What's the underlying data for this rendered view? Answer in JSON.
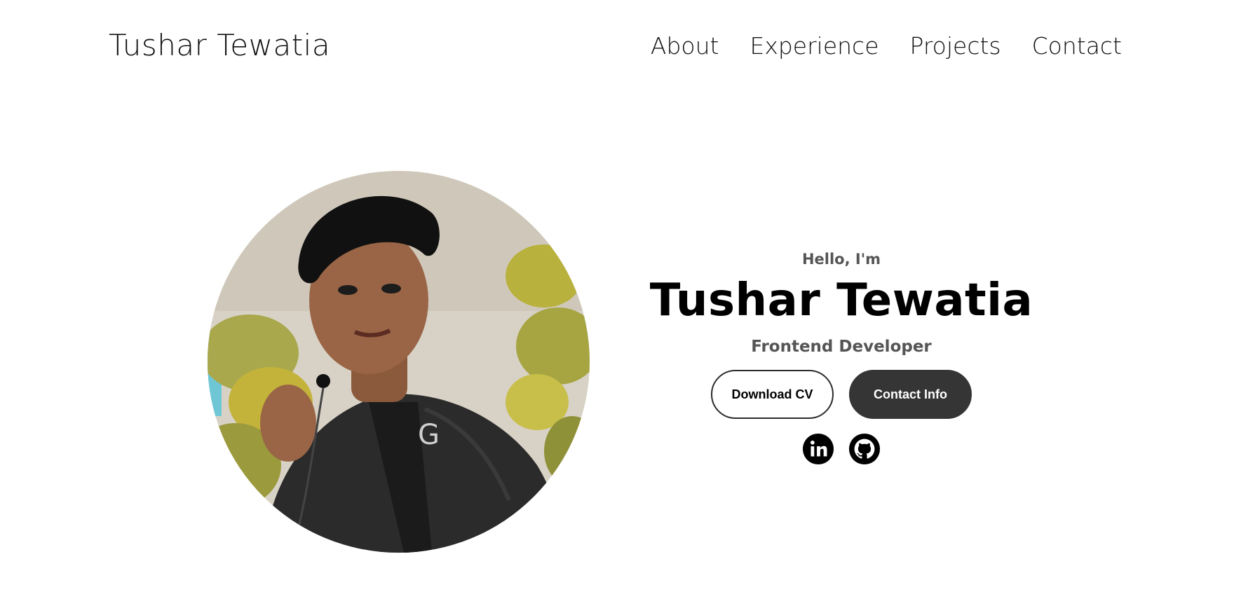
{
  "header": {
    "logo": "Tushar Tewatia",
    "nav": [
      {
        "label": "About"
      },
      {
        "label": "Experience"
      },
      {
        "label": "Projects"
      },
      {
        "label": "Contact"
      }
    ]
  },
  "hero": {
    "greeting": "Hello, I'm",
    "name": "Tushar Tewatia",
    "role": "Frontend Developer",
    "buttons": {
      "download_cv": "Download CV",
      "contact_info": "Contact Info"
    },
    "socials": [
      {
        "icon": "linkedin-icon"
      },
      {
        "icon": "github-icon"
      }
    ]
  },
  "colors": {
    "text": "#000000",
    "muted_text": "#555555",
    "button_dark": "#353535",
    "background": "#ffffff"
  }
}
